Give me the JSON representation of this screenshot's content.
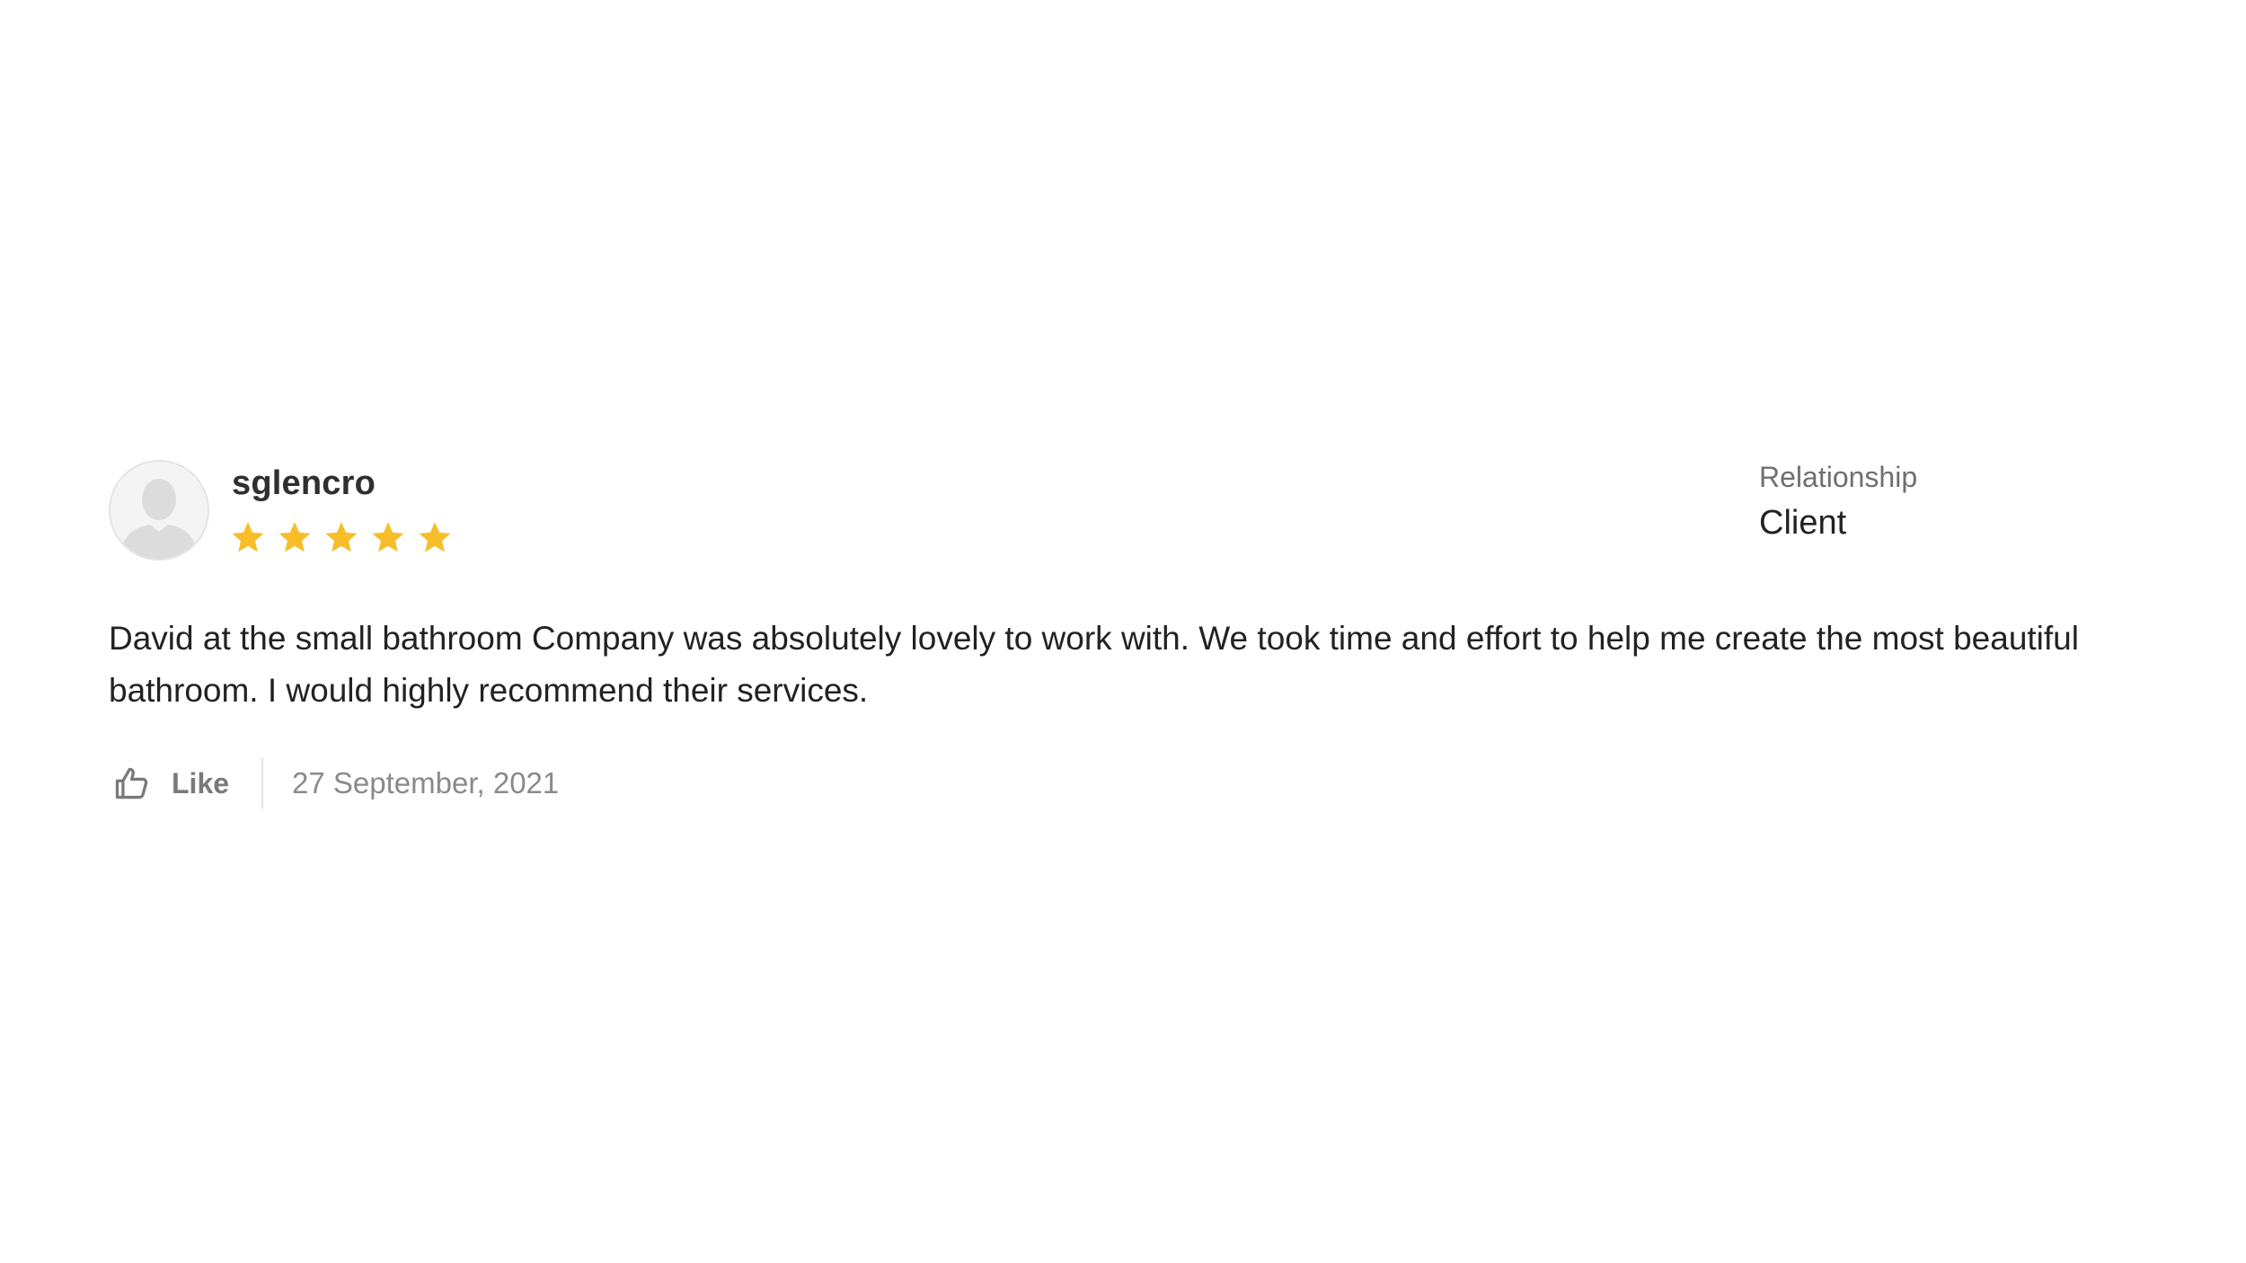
{
  "review": {
    "username": "sglencro",
    "avatar_icon": "default-user-avatar-icon",
    "rating": 5,
    "rating_max": 5,
    "star_color": "#F7BE2A",
    "relationship_label": "Relationship",
    "relationship_value": "Client",
    "text": "David at the small bathroom Company was absolutely lovely to work with. We took time and effort to help me create the most beautiful bathroom. I would highly recommend their services.",
    "like_label": "Like",
    "like_icon": "thumbs-up-icon",
    "date": "27 September, 2021"
  }
}
